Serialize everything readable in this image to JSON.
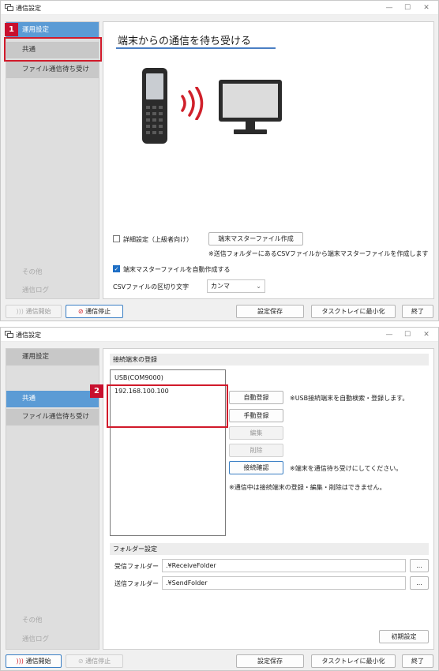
{
  "window1": {
    "title": "通信設定",
    "controls": {
      "minimize": "—",
      "maximize": "☐",
      "close": "✕"
    },
    "sidebar": {
      "items": [
        {
          "label": "運用設定"
        },
        {
          "label": "共通"
        },
        {
          "label": "ファイル通信待ち受け"
        },
        {
          "label": "その他"
        },
        {
          "label": "通信ログ"
        }
      ]
    },
    "main": {
      "heading": "端末からの通信を待ち受ける",
      "advanced_checkbox_label": "詳細設定（上級者向け）",
      "create_master_button": "端末マスターファイル作成",
      "create_master_note": "※送信フォルダーにあるCSVファイルから端末マスターファイルを作成します",
      "auto_create_label": "端末マスターファイルを自動作成する",
      "delimiter_label": "CSVファイルの区切り文字",
      "delimiter_value": "カンマ"
    },
    "footer": {
      "start_button": "通信開始",
      "stop_button": "通信停止",
      "save_button": "設定保存",
      "minimize_tray_button": "タスクトレイに最小化",
      "exit_button": "終了"
    },
    "callout_number": "1"
  },
  "window2": {
    "title": "通信設定",
    "controls": {
      "minimize": "—",
      "maximize": "☐",
      "close": "✕"
    },
    "sidebar": {
      "items": [
        {
          "label": "運用設定"
        },
        {
          "label": "共通"
        },
        {
          "label": "ファイル通信待ち受け"
        },
        {
          "label": "その他"
        },
        {
          "label": "通信ログ"
        }
      ]
    },
    "main": {
      "device_group_title": "接続端末の登録",
      "device_list": [
        "USB(COM9000)",
        "192.168.100.100"
      ],
      "auto_register_button": "自動登録",
      "auto_register_note": "※USB接続端末を自動検索・登録します。",
      "manual_register_button": "手動登録",
      "edit_button": "編集",
      "delete_button": "削除",
      "confirm_button": "接続確認",
      "confirm_note": "※端末を通信待ち受けにしてください。",
      "in_comm_note": "※通信中は接続端末の登録・編集・削除はできません。",
      "folder_group_title": "フォルダー設定",
      "receive_folder_label": "受信フォルダー",
      "receive_folder_value": ".¥ReceiveFolder",
      "send_folder_label": "送信フォルダー",
      "send_folder_value": ".¥SendFolder",
      "browse_label": "...",
      "reset_button": "初期設定"
    },
    "footer": {
      "start_button": "通信開始",
      "stop_button": "通信停止",
      "save_button": "設定保存",
      "minimize_tray_button": "タスクトレイに最小化",
      "exit_button": "終了"
    },
    "callout_number": "2"
  },
  "colors": {
    "accent": "#5b9bd5",
    "callout": "#c8102e",
    "signal": "#d0202a"
  }
}
